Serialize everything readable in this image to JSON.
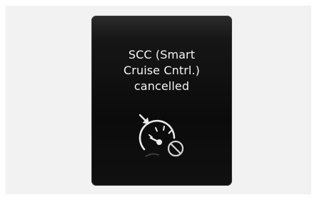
{
  "dialog": {
    "message_lines": [
      "SCC (Smart",
      "Cruise Cntrl.)",
      "cancelled"
    ],
    "icon": "scc-cancelled-icon",
    "colors": {
      "panel": "#0b0b0b",
      "text": "#f4f4f4",
      "icon": "#eaeaea"
    }
  }
}
